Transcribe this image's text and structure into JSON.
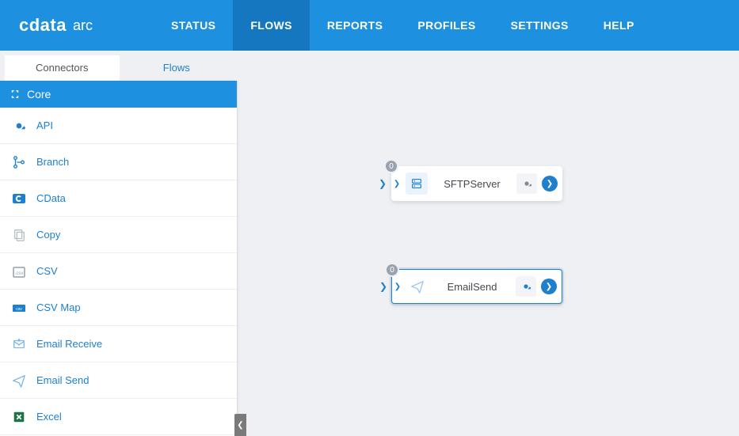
{
  "logo": {
    "main": "cdata",
    "sub": "arc"
  },
  "nav": {
    "items": [
      {
        "label": "STATUS"
      },
      {
        "label": "FLOWS",
        "active": true
      },
      {
        "label": "REPORTS"
      },
      {
        "label": "PROFILES"
      },
      {
        "label": "SETTINGS"
      },
      {
        "label": "HELP"
      }
    ]
  },
  "sideTabs": {
    "connectors": "Connectors",
    "flows": "Flows",
    "active": "connectors"
  },
  "coreHeader": "Core",
  "connectors": [
    {
      "label": "API",
      "icon": "api-icon"
    },
    {
      "label": "Branch",
      "icon": "branch-icon"
    },
    {
      "label": "CData",
      "icon": "cdata-icon"
    },
    {
      "label": "Copy",
      "icon": "copy-icon"
    },
    {
      "label": "CSV",
      "icon": "csv-icon"
    },
    {
      "label": "CSV Map",
      "icon": "csvmap-icon"
    },
    {
      "label": "Email Receive",
      "icon": "emailreceive-icon"
    },
    {
      "label": "Email Send",
      "icon": "emailsend-icon"
    },
    {
      "label": "Excel",
      "icon": "excel-icon"
    }
  ],
  "nodes": {
    "sftp": {
      "label": "SFTPServer",
      "badge": "0",
      "selected": false
    },
    "email": {
      "label": "EmailSend",
      "badge": "0",
      "selected": true
    }
  },
  "colors": {
    "accent": "#1e90e0",
    "link": "#1e80cd",
    "excel": "#1f7244"
  }
}
